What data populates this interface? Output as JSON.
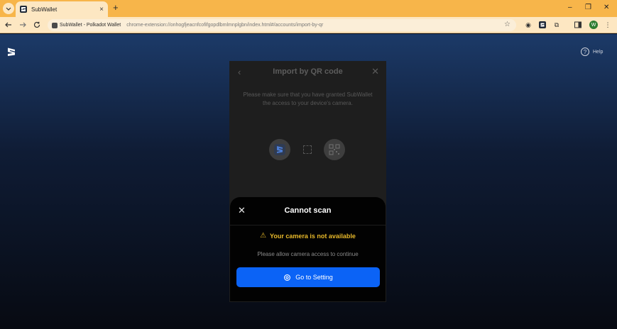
{
  "browser": {
    "tab_title": "SubWallet",
    "tab_close": "×",
    "new_tab": "+",
    "site_chip": "SubWallet - Polkadot Wallet",
    "url": "chrome-extension://onhogfjeacnfcofifgopdlbmlmnplgbn/index.html#/accounts/import-by-qr",
    "profile_initial": "W",
    "minimize": "–",
    "maximize": "❐",
    "close": "✕"
  },
  "header": {
    "help_label": "Help"
  },
  "modal": {
    "title": "Import by QR code",
    "description": "Please make sure that you have granted SubWallet the access to your device's camera."
  },
  "sheet": {
    "title": "Cannot scan",
    "warning": "Your camera is not available",
    "description": "Please allow camera access to continue",
    "button_label": "Go to Setting"
  },
  "colors": {
    "accent": "#0b63f6",
    "warning": "#e7b82a",
    "tabstrip": "#f7b54a"
  }
}
